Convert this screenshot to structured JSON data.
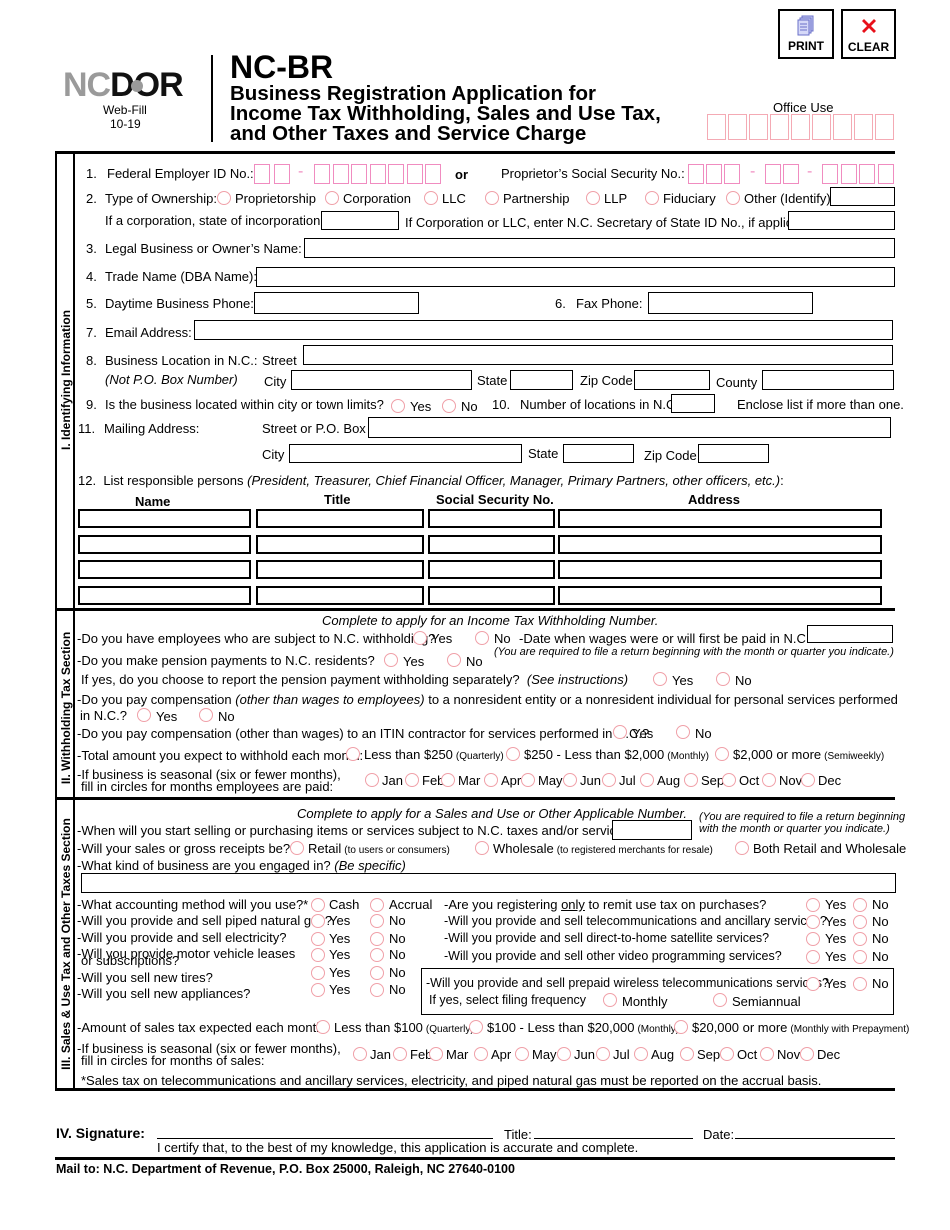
{
  "header": {
    "logo_nc": "NC",
    "logo_dor": "DOR",
    "edition_line1": "Web-Fill",
    "edition_line2": "10-19",
    "form_code": "NC-BR",
    "title_line1": "Business Registration Application for",
    "title_line2": "Income Tax Withholding, Sales and Use Tax,",
    "title_line3": "and Other Taxes and Service Charge",
    "office_use_label": "Office Use",
    "print_label": "PRINT",
    "clear_label": "CLEAR"
  },
  "section1": {
    "side_label": "I.  Identifying Information",
    "q1_num": "1.",
    "q1_label": "Federal Employer ID No.:",
    "q1_dash": "-",
    "q1_or": "or",
    "q1_ssn_label": "Proprietor’s Social Security No.:",
    "q2_num": "2.",
    "q2_label": "Type of Ownership:",
    "ownership_options": [
      "Proprietorship",
      "Corporation",
      "LLC",
      "Partnership",
      "LLP",
      "Fiduciary",
      "Other (Identify)"
    ],
    "q2_state_label": "If a corporation, state of incorporation:",
    "q2_sos_label": "If Corporation or LLC, enter N.C. Secretary of State ID No., if applicable:",
    "q3_num": "3.",
    "q3_label": "Legal Business or Owner’s Name:",
    "q4_num": "4.",
    "q4_label": "Trade Name (DBA Name):",
    "q5_num": "5.",
    "q5_label": "Daytime Business Phone:",
    "q6_num": "6.",
    "q6_label": "Fax Phone:",
    "q7_num": "7.",
    "q7_label": "Email Address:",
    "q8_num": "8.",
    "q8_label": "Business Location in N.C.:",
    "q8_note": "(Not P.O. Box Number)",
    "street_label": "Street",
    "city_label": "City",
    "state_label": "State",
    "zip_label": "Zip Code",
    "county_label": "County",
    "q9_num": "9.",
    "q9_label": "Is the business located within city or town limits?",
    "yes": "Yes",
    "no": "No",
    "q10_num": "10.",
    "q10_label": "Number of locations in N.C.",
    "q10_note": "Enclose list if more than one.",
    "q11_num": "11.",
    "q11_label": "Mailing Address:",
    "q11_street_label": "Street or P.O. Box",
    "q12_num": "12.",
    "q12_label": "List responsible persons",
    "q12_note": "(President, Treasurer, Chief Financial Officer, Manager, Primary Partners, other officers, etc.)",
    "q12_colon": ":",
    "table_headers": [
      "Name",
      "Title",
      "Social Security No.",
      "Address"
    ],
    "table_rows": 4
  },
  "section2": {
    "side_label": "II.  Withholding Tax Section",
    "intro": "Complete to apply for an Income Tax Withholding Number.",
    "q_employees": "-Do you have employees who are subject to N.C. withholding?",
    "q_date_wages": "-Date when wages were or will first be paid in N.C.:",
    "date_note": "(You are required to file a return beginning with the month or quarter you indicate.)",
    "q_pension": "-Do you make pension payments to N.C. residents?",
    "q_pension_sep": "If yes, do you choose to report the pension payment withholding separately?",
    "q_pension_sep_note": "(See instructions)",
    "q_nonres_a": "-Do you pay compensation ",
    "q_nonres_it": "(other than wages to employees)",
    "q_nonres_b": " to a nonresident entity or a nonresident individual for personal services performed",
    "q_nonres_c": "in N.C.?",
    "q_itin": "-Do you pay compensation (other than wages) to an ITIN contractor for services performed in N.C.?",
    "q_total": "-Total amount you expect to withhold each month:",
    "total_options": [
      {
        "label": "Less than $250",
        "note": "(Quarterly)"
      },
      {
        "label": "$250 - Less than $2,000",
        "note": "(Monthly)"
      },
      {
        "label": "$2,000 or more",
        "note": "(Semiweekly)"
      }
    ],
    "q_seasonal_1": "-If business is seasonal (six or fewer months),",
    "q_seasonal_2": "fill in circles for months employees are paid:"
  },
  "months": [
    "Jan",
    "Feb",
    "Mar",
    "Apr",
    "May",
    "Jun",
    "Jul",
    "Aug",
    "Sep",
    "Oct",
    "Nov",
    "Dec"
  ],
  "section3": {
    "side_label": "III.  Sales & Use Tax and Other Taxes Section",
    "intro": "Complete to apply for a Sales and Use or Other Applicable Number.",
    "intro_note_1": "(You are required to file a return beginning",
    "intro_note_2": "with the month or quarter you indicate.)",
    "q_start": "-When will you start selling or purchasing items or services subject to N.C. taxes and/or service charge?",
    "q_receipts": "-Will your sales or gross receipts be?",
    "receipt_options": [
      {
        "label": "Retail",
        "note": "(to users or consumers)"
      },
      {
        "label": "Wholesale",
        "note": "(to registered merchants for resale)"
      },
      {
        "label": "Both Retail and Wholesale",
        "note": ""
      }
    ],
    "q_kind": "-What kind of business are you engaged in?",
    "q_kind_note": "(Be specific)",
    "q_accounting": "-What accounting method will you use?*",
    "cash": "Cash",
    "accrual": "Accrual",
    "left_questions": [
      "-Will you provide and sell piped natural gas?",
      "-Will you provide and sell electricity?",
      "-Will you provide motor vehicle leases",
      "-Will you sell new tires?",
      "-Will you sell new appliances?"
    ],
    "left_q3_cont": "or subscriptions?",
    "q_use_only_a": "-Are you registering ",
    "q_use_only_u": "only",
    "q_use_only_b": " to remit use tax on purchases?",
    "right_questions": [
      "-Will you provide and sell telecommunications and ancillary services?",
      "-Will you provide and sell direct-to-home satellite services?",
      "-Will you provide and sell other video programming services?"
    ],
    "q_prepaid": "-Will you provide and sell prepaid wireless telecommunications services?",
    "q_filing_freq": "If yes, select filing frequency",
    "monthly": "Monthly",
    "semiannual": "Semiannual",
    "q_amount": "-Amount of sales tax expected each month:",
    "amount_options": [
      {
        "label": "Less than $100",
        "note": "(Quarterly)"
      },
      {
        "label": "$100 - Less than $20,000",
        "note": "(Monthly)"
      },
      {
        "label": "$20,000 or more",
        "note": "(Monthly with Prepayment)"
      }
    ],
    "q_seasonal_1": "-If business is seasonal (six or fewer months),",
    "q_seasonal_2": "fill in circles for months of sales:",
    "footnote": "*Sales tax on telecommunications and ancillary services, electricity, and piped natural gas must be reported on the accrual basis."
  },
  "section4": {
    "label": "IV.  Signature:",
    "title_label": "Title:",
    "date_label": "Date:",
    "certify": "I certify that, to the best of my knowledge, this application is accurate and complete."
  },
  "footer": {
    "mail_to": "Mail to:  N.C. Department of Revenue, P.O. Box 25000, Raleigh, NC 27640-0100"
  }
}
